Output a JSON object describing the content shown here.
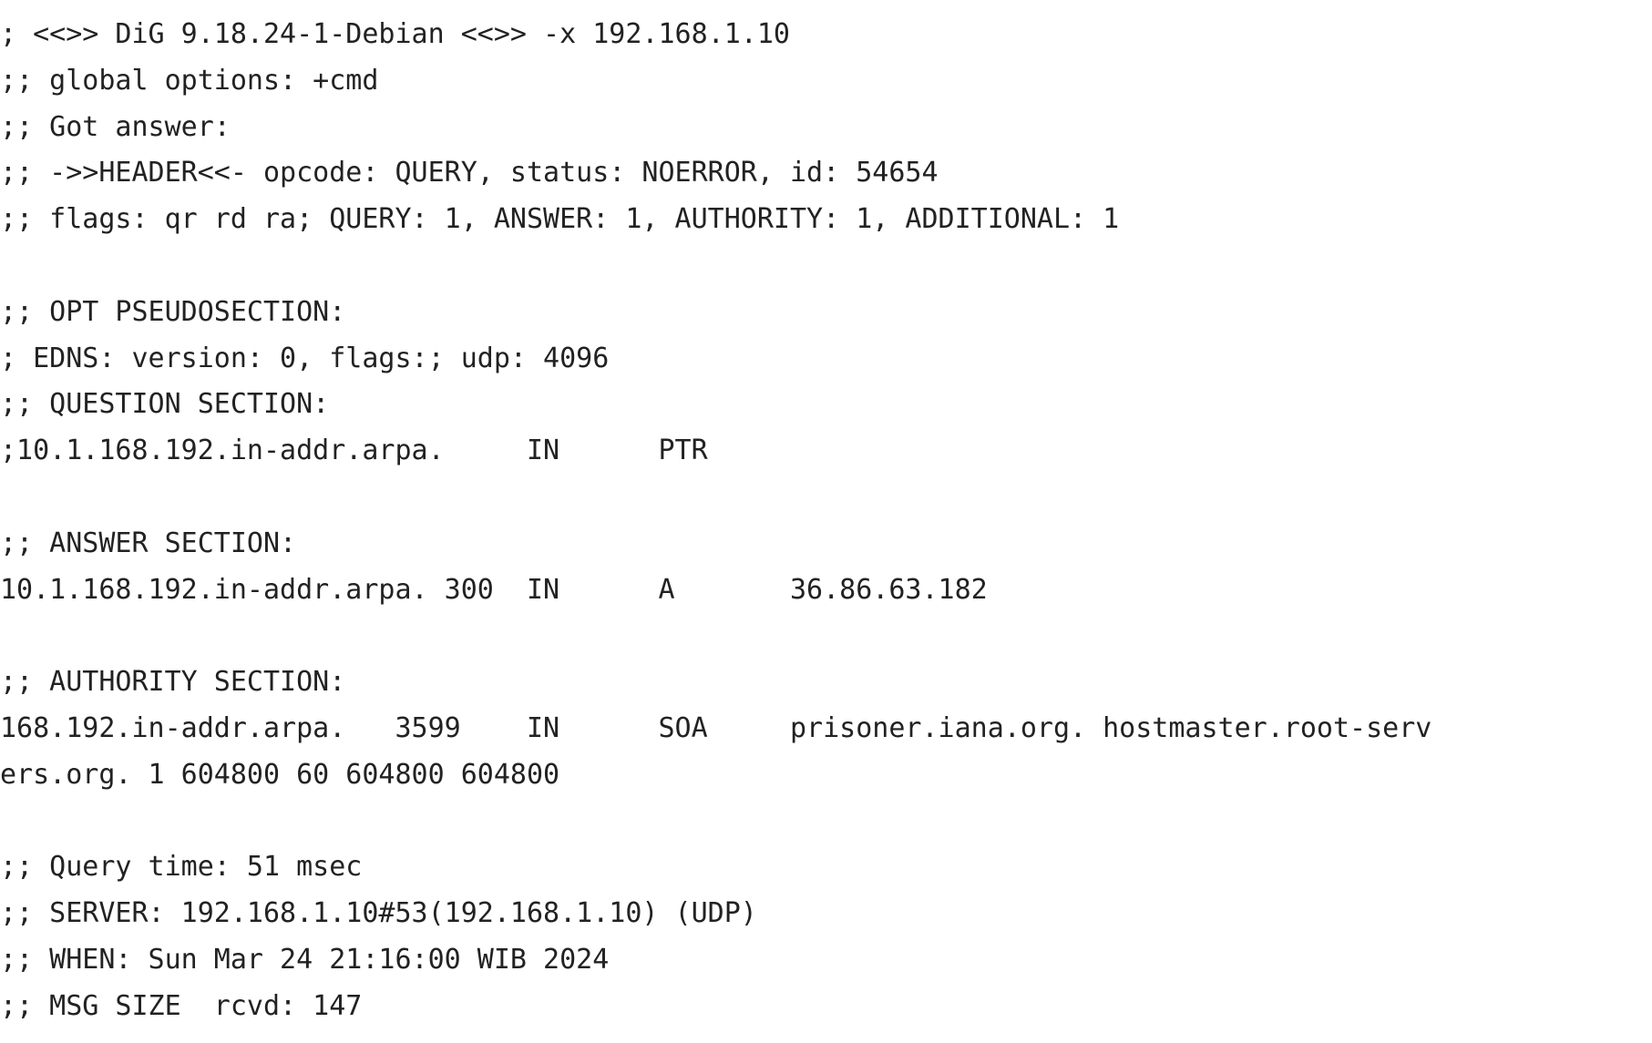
{
  "terminal": {
    "lines": [
      "; <<>> DiG 9.18.24-1-Debian <<>> -x 192.168.1.10",
      ";; global options: +cmd",
      ";; Got answer:",
      ";; ->>HEADER<<- opcode: QUERY, status: NOERROR, id: 54654",
      ";; flags: qr rd ra; QUERY: 1, ANSWER: 1, AUTHORITY: 1, ADDITIONAL: 1",
      "",
      ";; OPT PSEUDOSECTION:",
      "; EDNS: version: 0, flags:; udp: 4096",
      ";; QUESTION SECTION:",
      ";10.1.168.192.in-addr.arpa.     IN      PTR",
      "",
      ";; ANSWER SECTION:",
      "10.1.168.192.in-addr.arpa. 300  IN      A       36.86.63.182",
      "",
      ";; AUTHORITY SECTION:",
      "168.192.in-addr.arpa.   3599    IN      SOA     prisoner.iana.org. hostmaster.root-serv",
      "ers.org. 1 604800 60 604800 604800",
      "",
      ";; Query time: 51 msec",
      ";; SERVER: 192.168.1.10#53(192.168.1.10) (UDP)",
      ";; WHEN: Sun Mar 24 21:16:00 WIB 2024",
      ";; MSG SIZE  rcvd: 147"
    ]
  }
}
